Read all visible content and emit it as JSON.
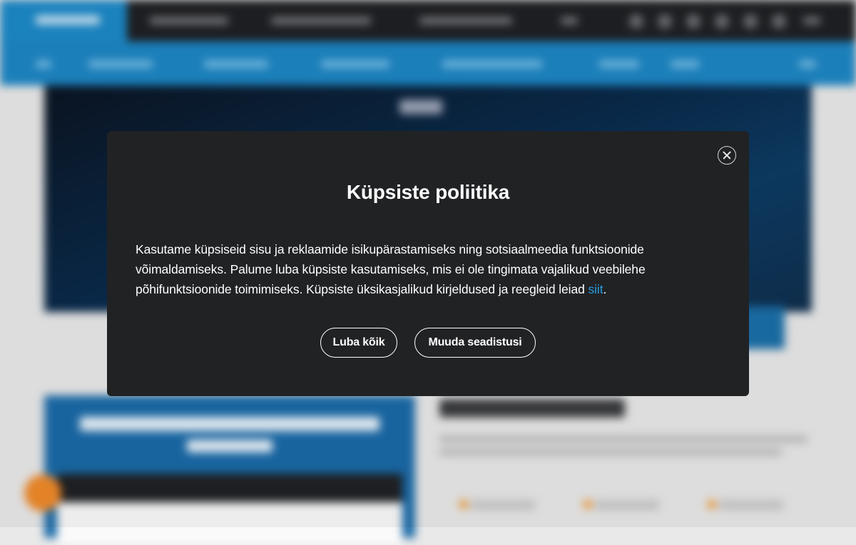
{
  "cookie_modal": {
    "title": "Küpsiste poliitika",
    "body_text": "Kasutame küpsiseid sisu ja reklaamide isikupärastamiseks ning sotsiaalmeedia funktsioonide võimaldamiseks. Palume luba küpsiste kasutamiseks, mis ei ole tingimata vajalikud veebilehe põhifunktsioonide toimimiseks. Küpsiste üksikasjalikud kirjeldused ja reegleid leiad ",
    "link_text": "siit",
    "body_end": ".",
    "accept_all_label": "Luba kõik",
    "change_settings_label": "Muuda seadistusi",
    "close_icon": "close-icon"
  },
  "colors": {
    "modal_bg": "#212224",
    "link": "#2a9be0",
    "brand_blue": "#1d86c4",
    "accent_orange": "#f08a2a"
  }
}
